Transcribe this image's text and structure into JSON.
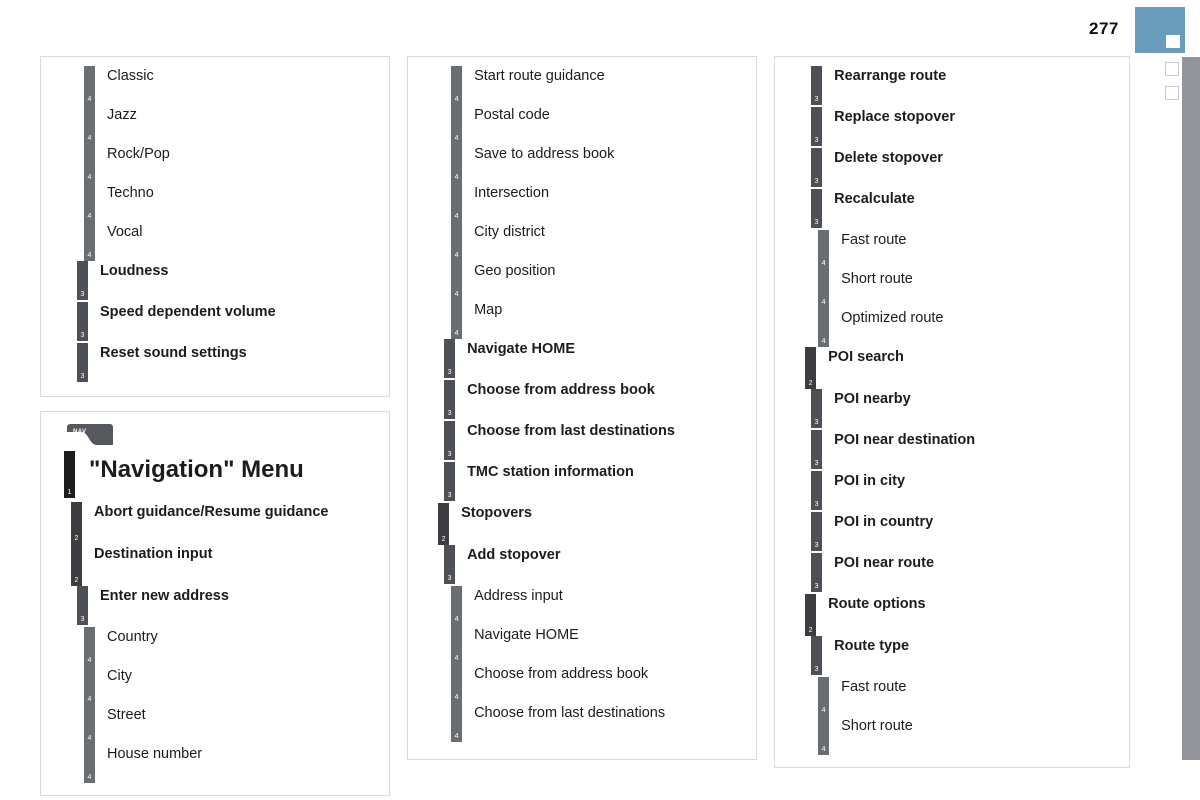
{
  "page": {
    "number": "277",
    "accent_color": "#6a9cbc",
    "edge_bar_color": "#929499",
    "marker_border_color": "#c6cdd2"
  },
  "icons": {
    "nav_badge_label": "NAV",
    "nav_badge_name": "nav-source-icon"
  },
  "levels": {
    "1": "#1d1d1d",
    "2": "#3b3d40",
    "3": "#4d5054",
    "4": "#6a6d72"
  },
  "columns": [
    {
      "id": "column-1",
      "panels": [
        {
          "id": "panel-sound-settings",
          "has_nav_icon": false,
          "rows": [
            {
              "level": 4,
              "label": "Classic"
            },
            {
              "level": 4,
              "label": "Jazz"
            },
            {
              "level": 4,
              "label": "Rock/Pop"
            },
            {
              "level": 4,
              "label": "Techno"
            },
            {
              "level": 4,
              "label": "Vocal"
            },
            {
              "level": 3,
              "label": "Loudness"
            },
            {
              "level": 3,
              "label": "Speed dependent volume"
            },
            {
              "level": 3,
              "label": "Reset sound settings"
            }
          ]
        },
        {
          "id": "panel-navigation-menu",
          "has_nav_icon": true,
          "rows": [
            {
              "level": 1,
              "label": "\"Navigation\" Menu"
            },
            {
              "level": 2,
              "label": "Abort guidance/Resume guidance"
            },
            {
              "level": 2,
              "label": "Destination input"
            },
            {
              "level": 3,
              "label": "Enter new address"
            },
            {
              "level": 4,
              "label": "Country"
            },
            {
              "level": 4,
              "label": "City"
            },
            {
              "level": 4,
              "label": "Street"
            },
            {
              "level": 4,
              "label": "House number"
            }
          ]
        }
      ]
    },
    {
      "id": "column-2",
      "panels": [
        {
          "id": "panel-destination-continued",
          "has_nav_icon": false,
          "rows": [
            {
              "level": 4,
              "label": "Start route guidance"
            },
            {
              "level": 4,
              "label": "Postal code"
            },
            {
              "level": 4,
              "label": "Save to address book"
            },
            {
              "level": 4,
              "label": "Intersection"
            },
            {
              "level": 4,
              "label": "City district"
            },
            {
              "level": 4,
              "label": "Geo position"
            },
            {
              "level": 4,
              "label": "Map"
            },
            {
              "level": 3,
              "label": "Navigate HOME"
            },
            {
              "level": 3,
              "label": "Choose from address book"
            },
            {
              "level": 3,
              "label": "Choose from last destinations"
            },
            {
              "level": 3,
              "label": "TMC station information"
            },
            {
              "level": 2,
              "label": "Stopovers"
            },
            {
              "level": 3,
              "label": "Add stopover"
            },
            {
              "level": 4,
              "label": "Address input"
            },
            {
              "level": 4,
              "label": "Navigate HOME"
            },
            {
              "level": 4,
              "label": "Choose from address book"
            },
            {
              "level": 4,
              "label": "Choose from last destinations"
            }
          ]
        }
      ]
    },
    {
      "id": "column-3",
      "panels": [
        {
          "id": "panel-route-poi",
          "has_nav_icon": false,
          "rows": [
            {
              "level": 3,
              "label": "Rearrange route"
            },
            {
              "level": 3,
              "label": "Replace stopover"
            },
            {
              "level": 3,
              "label": "Delete stopover"
            },
            {
              "level": 3,
              "label": "Recalculate"
            },
            {
              "level": 4,
              "label": "Fast route"
            },
            {
              "level": 4,
              "label": "Short route"
            },
            {
              "level": 4,
              "label": "Optimized route"
            },
            {
              "level": 2,
              "label": "POI search"
            },
            {
              "level": 3,
              "label": "POI nearby"
            },
            {
              "level": 3,
              "label": "POI near destination"
            },
            {
              "level": 3,
              "label": "POI in city"
            },
            {
              "level": 3,
              "label": "POI in country"
            },
            {
              "level": 3,
              "label": "POI near route"
            },
            {
              "level": 2,
              "label": "Route options"
            },
            {
              "level": 3,
              "label": "Route type"
            },
            {
              "level": 4,
              "label": "Fast route"
            },
            {
              "level": 4,
              "label": "Short route"
            }
          ]
        }
      ]
    }
  ]
}
